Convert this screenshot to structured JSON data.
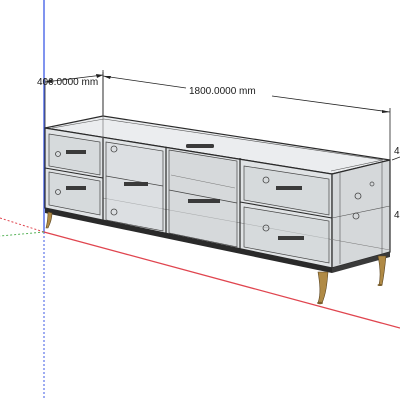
{
  "viewport": {
    "dimensions": {
      "depth_label": "400.0000 mm",
      "width_label": "1800.0000 mm",
      "height_label_partial": "4"
    },
    "axis_colors": {
      "red": "#e0454f",
      "green": "#58b35a",
      "blue": "#3c5ae6"
    },
    "model": {
      "name": "tv-cabinet",
      "frame_color": "#2a2a2a",
      "glass_color": "#d3d7da",
      "leg_color": "#b08a45"
    }
  }
}
